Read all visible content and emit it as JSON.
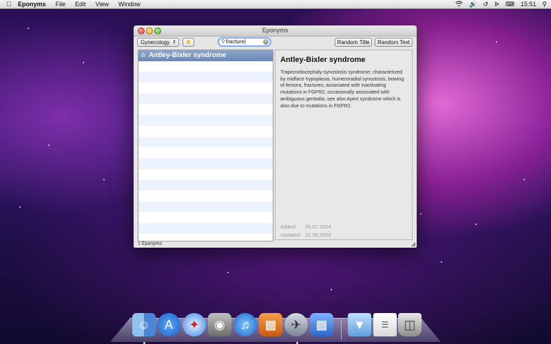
{
  "menubar": {
    "app_name": "Eponyms",
    "items": [
      "File",
      "Edit",
      "View",
      "Window"
    ],
    "clock": "15:51"
  },
  "window": {
    "title": "Eponyms",
    "toolbar": {
      "category": "Gynecology",
      "search_value": "fracture",
      "random_title": "Random Title",
      "random_text": "Random Text"
    },
    "list": {
      "items": [
        "Antley-Bixler syndrome"
      ]
    },
    "detail": {
      "title": "Antley-Bixler syndrome",
      "text": "Trapezoidocephaly-synostosis syndrome; characterized by midface hypoplasia, humeroradial synostosis, bowing of femora, fractures; associated with inactivating mutations in FGFR2; occasionally associated with ambiguous genitalia; see also Apert syndrome which is also due to mutations in FGFR2.",
      "added_label": "Added:",
      "added_value": "05.07.2004",
      "updated_label": "Updated:",
      "updated_value": "22.06.2009"
    },
    "status": "1 Eponyms"
  },
  "dock": {
    "icons": [
      "finder-icon",
      "app-store-icon",
      "safari-icon",
      "photo-booth-icon",
      "itunes-icon",
      "preview-icon",
      "mail-icon",
      "keynote-icon",
      "downloads-folder-icon",
      "document-icon",
      "trash-icon"
    ]
  },
  "colors": {
    "selection": "#6c88b6",
    "search_focus": "#7aaeea",
    "list_alt_row": "#edf3fe"
  }
}
